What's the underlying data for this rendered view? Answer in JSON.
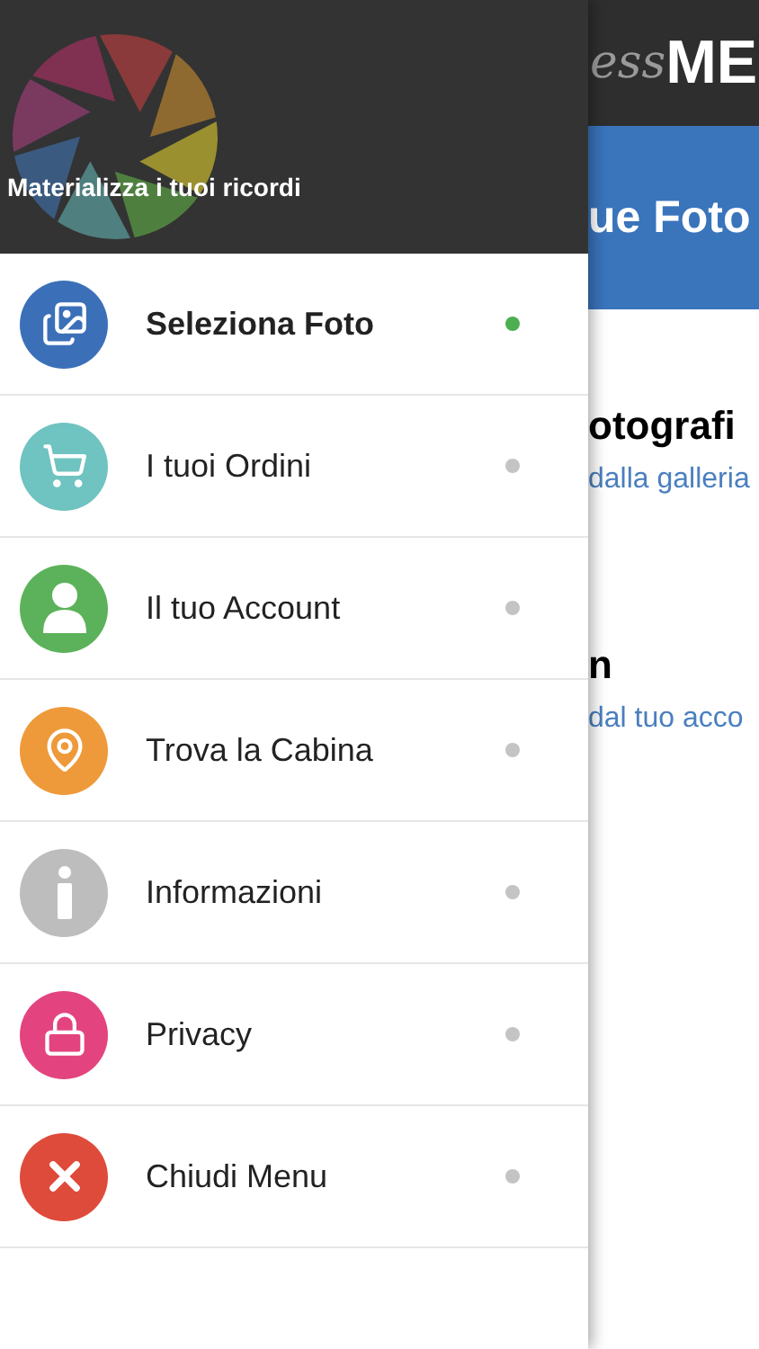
{
  "drawer": {
    "tagline": "Materializza i tuoi ricordi",
    "items": [
      {
        "label": "Seleziona Foto",
        "color": "#3b70b9",
        "selected": true
      },
      {
        "label": "I tuoi Ordini",
        "color": "#6fc3c0",
        "selected": false
      },
      {
        "label": "Il tuo Account",
        "color": "#5cb25a",
        "selected": false
      },
      {
        "label": "Trova la Cabina",
        "color": "#ee9a3a",
        "selected": false
      },
      {
        "label": "Informazioni",
        "color": "#bdbdbd",
        "selected": false
      },
      {
        "label": "Privacy",
        "color": "#e3447f",
        "selected": false
      },
      {
        "label": "Chiudi Menu",
        "color": "#df4b3b",
        "selected": false
      }
    ]
  },
  "page": {
    "logo_script": "ess",
    "logo_bold": "ME",
    "banner_title": "ue Foto",
    "sections": [
      {
        "title": "otografi",
        "subtitle": "dalla galleria"
      },
      {
        "title": "n",
        "subtitle": "dal tuo acco"
      }
    ]
  }
}
